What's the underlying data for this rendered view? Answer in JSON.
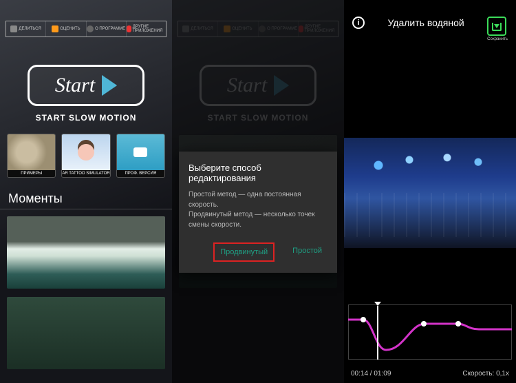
{
  "toolbar": {
    "share": "ДЕЛИТЬСЯ",
    "rate": "ОЦЕНИТЬ",
    "about": "О ПРОГРАММЕ",
    "more": "ДРУГИЕ ПРИЛОЖЕНИЯ"
  },
  "start": {
    "label": "Start",
    "caption": "START SLOW MOTION"
  },
  "tiles": {
    "examples": "ПРИМЕРЫ",
    "tattoo": "AR TATTOO SIMULATOR",
    "pro": "ПРОФ. ВЕРСИЯ"
  },
  "moments_heading": "Моменты",
  "dialog": {
    "title": "Выберите способ редактирования",
    "line1": "Простой метод — одна постоянная скорость.",
    "line2": "Продвинутый метод — несколько точек смены скорости.",
    "advanced": "Продвинутый",
    "simple": "Простой"
  },
  "panel3": {
    "remove_watermark": "Удалить водяной",
    "save": "Сохранить",
    "time": "00:14 / 01:09",
    "speed_label": "Скорость: 0,1x"
  }
}
